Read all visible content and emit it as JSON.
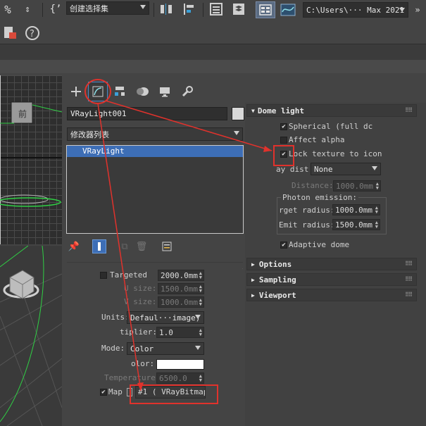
{
  "toolbar": {
    "selection_set_dropdown": "创建选择集",
    "path_dropdown": "C:\\Users\\··· Max 2021"
  },
  "viewport_top": {
    "label": "前"
  },
  "command_panel": {
    "object_name": "VRayLight001",
    "modifier_list": "修改器列表",
    "stack_items": [
      "VRayLight"
    ]
  },
  "params": {
    "targeted": {
      "label": "Targeted",
      "value": "2000.0mm"
    },
    "u_size": {
      "label": "U size:",
      "value": "1500.0mm"
    },
    "v_size": {
      "label": "V size:",
      "value": "1000.0mm"
    },
    "units": {
      "label": "Units:",
      "value": "Defaul···image)"
    },
    "multiplier": {
      "label": "tiplier:",
      "value": "1.0"
    },
    "mode": {
      "label": "Mode:",
      "value": "Color"
    },
    "color": {
      "label": "olor:",
      "value": "#ffffff"
    },
    "temperature": {
      "label": "Temperature:",
      "value": "6500.0"
    },
    "map": {
      "label": "Map",
      "value": "#1  ( VRayBitmap"
    }
  },
  "dome_light": {
    "title": "Dome light",
    "spherical": "Spherical (full dc",
    "affect_alpha": "Affect alpha",
    "lock_texture": "Lock texture to icon",
    "ray_dist_label": "ay dist:",
    "ray_dist_value": "None",
    "distance_label": "Distance:",
    "distance_value": "1000.0mm",
    "photon_emission": "Photon emission:",
    "target_radius_label": "rget radius:",
    "target_radius_value": "1000.0mm",
    "emit_radius_label": "Emit radius:",
    "emit_radius_value": "1500.0mm",
    "adaptive_dome": "Adaptive dome"
  },
  "rollouts": [
    "Options",
    "Sampling",
    "Viewport"
  ],
  "colors": {
    "highlight": "#3d6eb6",
    "annotation": "#e0322c",
    "panel": "#444444"
  }
}
